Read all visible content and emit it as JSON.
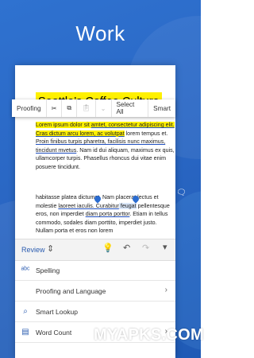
{
  "headline": "Work",
  "document": {
    "title": "Seattle’s Coffee Culture",
    "body_hl_1": "Lorem ipsum dolor sit ",
    "body_link_1": "amtet, consectetur adipiscing elit. Cras dictum arcu lorem, ac volutpat",
    "body_rest_1": " lorem tempus et. ",
    "body_link_2": "Proin finibus turpis pharetra, facilisis nunc maximus, tincidunt mvetus",
    "body_rest_2": ". Nam id dui aliquam, maximus ex quis, ullamcorper turpis. Phasellus rhoncus dui vitae enim posuere tincidunt.",
    "body2_a": "habitasse platea dictumst. Nam placerat lectus et molestie ",
    "body2_b": "laoreet iaculis. Curabitur",
    "body2_sel": " feugat",
    "body2_c": " pellentesque eros, non imperdiet ",
    "body2_link": "diam porta porttor",
    "body2_d": ". Etiam in tellus commodo, sodales diam porttito, imperdiet justo. Nullam porta et eros non lorem"
  },
  "context_menu": {
    "proofing": "Proofing",
    "select_all": "Select All",
    "smart": "Smart"
  },
  "toolbar": {
    "tab_label": "Review"
  },
  "menu": {
    "items": [
      {
        "label": "Spelling",
        "icon": "spelling-icon"
      },
      {
        "label": "Proofing and Language",
        "icon": ""
      },
      {
        "label": "Smart Lookup",
        "icon": "smart-lookup-icon"
      },
      {
        "label": "Word Count",
        "icon": "word-count-icon"
      }
    ]
  },
  "watermark": "MYAPKS.COM",
  "colors": {
    "accent": "#2b5cb0",
    "highlight": "#fff100",
    "background": "#2a67c4"
  }
}
